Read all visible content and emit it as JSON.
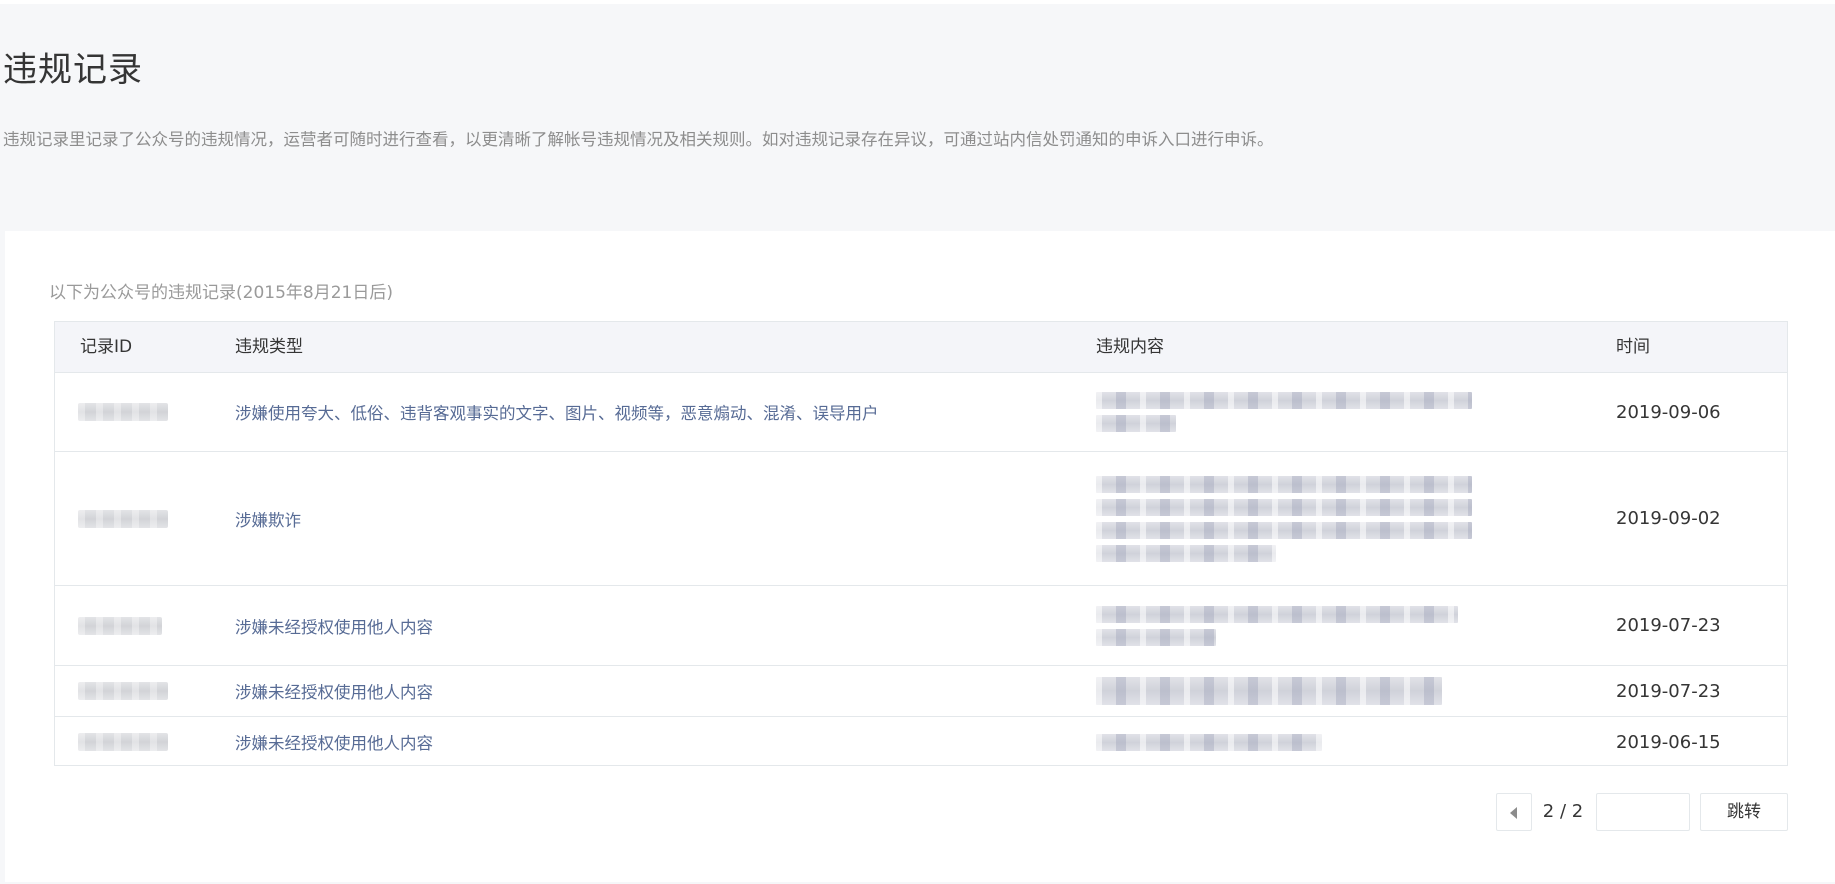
{
  "page": {
    "title": "违规记录",
    "description": "违规记录里记录了公众号的违规情况，运营者可随时进行查看，以更清晰了解帐号违规情况及相关规则。如对违规记录存在异议，可通过站内信处罚通知的申诉入口进行申诉。"
  },
  "records": {
    "caption": "以下为公众号的违规记录(2015年8月21日后)",
    "columns": {
      "id": "记录ID",
      "type": "违规类型",
      "content": "违规内容",
      "time": "时间"
    },
    "rows": [
      {
        "type": "涉嫌使用夸大、低俗、违背客观事实的文字、图片、视频等，恶意煽动、混淆、误导用户",
        "time": "2019-09-06"
      },
      {
        "type": "涉嫌欺诈",
        "time": "2019-09-02"
      },
      {
        "type": "涉嫌未经授权使用他人内容",
        "time": "2019-07-23"
      },
      {
        "type": "涉嫌未经授权使用他人内容",
        "time": "2019-07-23"
      },
      {
        "type": "涉嫌未经授权使用他人内容",
        "time": "2019-06-15"
      }
    ]
  },
  "pagination": {
    "indicator": "2 / 2",
    "input_value": "",
    "jump_label": "跳转"
  },
  "colors": {
    "link": "#576b95",
    "page_background": "#f6f7f9",
    "header_background": "#f4f5f9",
    "border": "#e4e8eb"
  },
  "icons": {
    "prev_page": "caret-left-icon"
  }
}
